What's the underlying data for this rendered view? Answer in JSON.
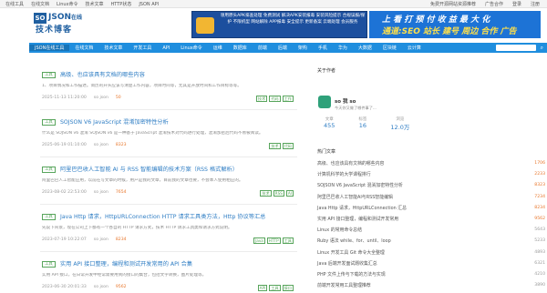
{
  "topbar": {
    "left": [
      "在线工具",
      "在线文档",
      "Linux命令",
      "技术文章",
      "HTTP状态",
      "JSON API"
    ],
    "notice": "免费开源网站资源推荐",
    "promo": "广告合作",
    "right": [
      "登录",
      "注册"
    ]
  },
  "logo": {
    "badge": "SO",
    "text": "JSON",
    "sup": "在线",
    "sub": "技术博客"
  },
  "ads": {
    "left": "领用原头APK排查处理 免费测试 解决APK安装报毒 安装风险提示 合规误报/保护 不限机型 网站解除 APP报毒 安全提示 更新备案 云端处理 会员服务",
    "right_line1": "上 看 打 预 付  收 益 最 大 化",
    "right_line2": "通道:SEO 站长 建号 周边 合作 广告"
  },
  "nav": {
    "items": [
      "JSON在线工具",
      "在线文档",
      "技术文章",
      "开发工具",
      "API",
      "Linux命令",
      "运维",
      "数据库",
      "前端",
      "后端",
      "架构",
      "手机",
      "华为",
      "大数据",
      "区块链",
      "云计算",
      "博客",
      "热门"
    ],
    "active_index": 0
  },
  "articles": [
    {
      "tag": "工具",
      "title": "高级、也应该具有文档的哪些内容",
      "desc": "1、项目情况和工作描述。简历的开头应该写清楚工作内容，项目时间等，尤其是开放时间和工作目标等等。",
      "date": "2025-11-13 11:20:00",
      "author": "so json",
      "views": "50",
      "labels": [
        "技术",
        "代码",
        "工作"
      ]
    },
    {
      "tag": "工具",
      "title": "SOJSON V6 JavaScript 混淆加密特性分析",
      "desc": "什么是 SOJSON v6 混淆 SOJSON v6 是一种基于 JavaScript 混淆技术对代码进行处理，混淆加密后代码不易被阅读。",
      "date": "2025-06-19 01:10:00",
      "author": "so json",
      "views": "8323",
      "labels": [
        "技术",
        "代码"
      ]
    },
    {
      "tag": "工具",
      "title": "阿里巴巴收人工智能 AI 与 RSS 智能编辑的技术方案（RSS 格式解析）",
      "desc": "阿里巴巴人工智能应用，以前在写文章的时候，用户是我的文章，目前我的文章也要，不会本人使用相应的。",
      "date": "2023-08-02 22:53:00",
      "author": "so json",
      "views": "7654",
      "labels": [
        "技术",
        "RSS",
        "AI"
      ]
    },
    {
      "tag": "工具",
      "title": "Java Http 请求，HttpURLConnection HTTP 请求工具类方法，Http 协议等汇总",
      "desc": "先说下背景，现在公司上下都有一个各自的 HTTP 请求方式，技术 HTTP 请求工具类和请求方式说明。",
      "date": "2023-07-19 10:22:07",
      "author": "so json",
      "views": "8234",
      "labels": [
        "Java",
        "HTTP",
        "工具"
      ]
    },
    {
      "tag": "工具",
      "title": "实用 API 接口整理，编程和测试开发常用的 API 合集",
      "desc": "实用 API 接口，在日常开发中经常需要用到的接口的集合，包括文字转换，图片处理等。",
      "date": "2023-06-30 20:01:33",
      "author": "so json",
      "views": "9562",
      "labels": [
        "API",
        "工具",
        "接口"
      ]
    }
  ],
  "sidebar": {
    "head": "关于作者",
    "name": "so 我 so",
    "motto": "今天你又做了哪件事了...",
    "stats": [
      {
        "k": "文章",
        "v": "455"
      },
      {
        "k": "标签",
        "v": "16"
      },
      {
        "k": "浏览",
        "v": "12.0万"
      }
    ],
    "hot_title": "热门文章",
    "hot": [
      {
        "t": "高级、也应该具有文档的哪些内容",
        "v": "1706"
      },
      {
        "t": "计算机科学的大学课程排行",
        "v": "2233"
      },
      {
        "t": "SOJSON V6 JavaScript 混淆加密特性分析",
        "v": "8323"
      },
      {
        "t": "阿里巴巴收人工智能AI与RSS智能编辑",
        "v": "7234"
      },
      {
        "t": "Java Http 请求，HttpURLConnection 汇总",
        "v": "8234"
      },
      {
        "t": "实用 API 接口整理，编程和测试开发常用",
        "v": "9562"
      },
      {
        "t": "Linux 的常用命令总结",
        "v": "5643"
      },
      {
        "t": "Ruby 语法 while、for、until、loop",
        "v": "5233"
      },
      {
        "t": "Linux 开发工具 Git 命令大全整理",
        "v": "4893"
      },
      {
        "t": "Java 后端开发面试题收集汇总",
        "v": "6321"
      },
      {
        "t": "PHP 文件上传与下载的方法与实现",
        "v": "4210"
      },
      {
        "t": "前端开发常用工具整理推荐",
        "v": "3890"
      }
    ]
  }
}
